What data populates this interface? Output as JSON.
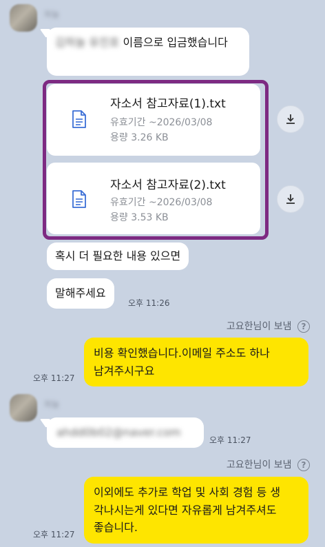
{
  "messages": {
    "sender_name_blurred": "하늘",
    "msg1_blurred_prefix": "김하늘 유진호",
    "msg1_text": "이름으로 입금했습니다",
    "file1": {
      "name": "자소서 참고자료(1).txt",
      "validity": "유효기간 ~2026/03/08",
      "size": "용량 3.26 KB"
    },
    "file2": {
      "name": "자소서 참고자료(2).txt",
      "validity": "유효기간 ~2026/03/08",
      "size": "용량 3.53 KB"
    },
    "msg2_text": "혹시 더 필요한 내용 있으면",
    "msg3_text": "말해주세요",
    "msg3_time": "오후 11:26",
    "sent_label_1": "고요한님이 보냄",
    "reply1_line1": "비용 확인했습니다.이메일 주소도 하나",
    "reply1_line2": "남겨주시구요",
    "reply1_time": "오후 11:27",
    "sender2_name_blurred": "하늘",
    "email_blurred": "ahdd0b02@naver.com",
    "email_time": "오후 11:27",
    "sent_label_2": "고요한님이 보냄",
    "reply2_line1": "이외에도 추가로 학업 및 사회 경험 등 생",
    "reply2_line2": "각나시는게 있다면 자유롭게 남겨주셔도",
    "reply2_line3": "좋습니다.",
    "reply2_time": "오후 11:27",
    "help_glyph": "?"
  },
  "colors": {
    "background": "#c9d3e2",
    "bubble_white": "#ffffff",
    "bubble_yellow": "#fee500",
    "highlight_border": "#7d2a82",
    "file_icon": "#3b6fd6"
  },
  "icons": {
    "file": "document-icon",
    "download": "download-icon",
    "help": "help-circle-icon"
  }
}
